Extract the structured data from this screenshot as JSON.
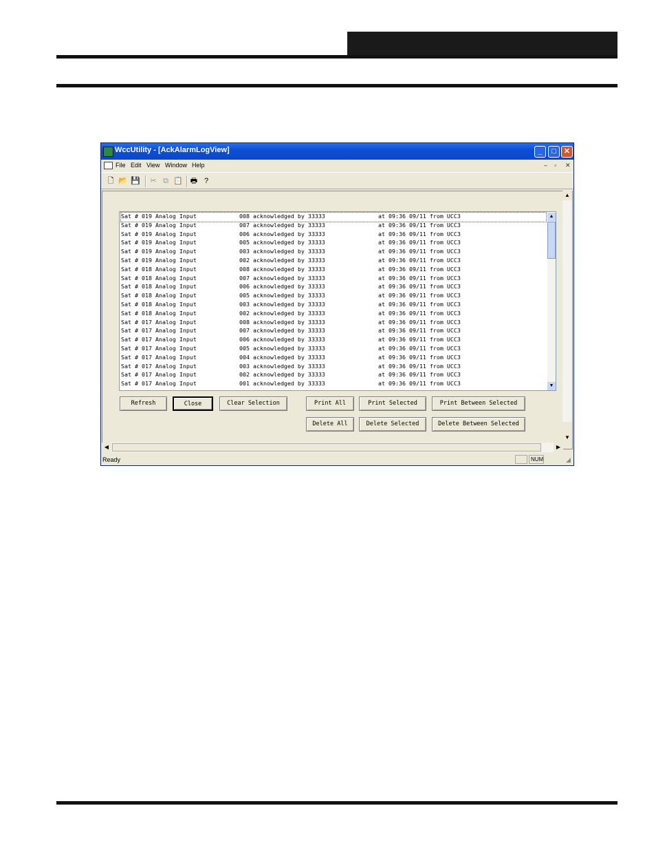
{
  "window": {
    "title": "WccUtility - [AckAlarmLogView]",
    "menu": [
      "File",
      "Edit",
      "View",
      "Window",
      "Help"
    ],
    "title_buttons": {
      "minimize": "_",
      "maximize": "□",
      "close": "✕"
    },
    "mdi_controls": {
      "minimize": "–",
      "restore": "▫",
      "close": "✕"
    }
  },
  "toolbar": {
    "icons": [
      "new-icon",
      "open-icon",
      "save-icon",
      "cut-icon",
      "copy-icon",
      "paste-icon",
      "print-icon",
      "help-icon"
    ]
  },
  "log": {
    "rows": [
      [
        "Sat # 019 Analog Input",
        "008 acknowledged by 33333",
        "at 09:36 09/11 from UCC3"
      ],
      [
        "Sat # 019 Analog Input",
        "007 acknowledged by 33333",
        "at 09:36 09/11 from UCC3"
      ],
      [
        "Sat # 019 Analog Input",
        "006 acknowledged by 33333",
        "at 09:36 09/11 from UCC3"
      ],
      [
        "Sat # 019 Analog Input",
        "005 acknowledged by 33333",
        "at 09:36 09/11 from UCC3"
      ],
      [
        "Sat # 019 Analog Input",
        "003 acknowledged by 33333",
        "at 09:36 09/11 from UCC3"
      ],
      [
        "Sat # 019 Analog Input",
        "002 acknowledged by 33333",
        "at 09:36 09/11 from UCC3"
      ],
      [
        "Sat # 018 Analog Input",
        "008 acknowledged by 33333",
        "at 09:36 09/11 from UCC3"
      ],
      [
        "Sat # 018 Analog Input",
        "007 acknowledged by 33333",
        "at 09:36 09/11 from UCC3"
      ],
      [
        "Sat # 018 Analog Input",
        "006 acknowledged by 33333",
        "at 09:36 09/11 from UCC3"
      ],
      [
        "Sat # 018 Analog Input",
        "005 acknowledged by 33333",
        "at 09:36 09/11 from UCC3"
      ],
      [
        "Sat # 018 Analog Input",
        "003 acknowledged by 33333",
        "at 09:36 09/11 from UCC3"
      ],
      [
        "Sat # 018 Analog Input",
        "002 acknowledged by 33333",
        "at 09:36 09/11 from UCC3"
      ],
      [
        "Sat # 017 Analog Input",
        "008 acknowledged by 33333",
        "at 09:36 09/11 from UCC3"
      ],
      [
        "Sat # 017 Analog Input",
        "007 acknowledged by 33333",
        "at 09:36 09/11 from UCC3"
      ],
      [
        "Sat # 017 Analog Input",
        "006 acknowledged by 33333",
        "at 09:36 09/11 from UCC3"
      ],
      [
        "Sat # 017 Analog Input",
        "005 acknowledged by 33333",
        "at 09:36 09/11 from UCC3"
      ],
      [
        "Sat # 017 Analog Input",
        "004 acknowledged by 33333",
        "at 09:36 09/11 from UCC3"
      ],
      [
        "Sat # 017 Analog Input",
        "003 acknowledged by 33333",
        "at 09:36 09/11 from UCC3"
      ],
      [
        "Sat # 017 Analog Input",
        "002 acknowledged by 33333",
        "at 09:36 09/11 from UCC3"
      ],
      [
        "Sat # 017 Analog Input",
        "001 acknowledged by 33333",
        "at 09:36 09/11 from UCC3"
      ]
    ]
  },
  "buttons": {
    "refresh": "Refresh",
    "close": "Close",
    "clear_selection": "Clear Selection",
    "print_all": "Print All",
    "print_selected": "Print Selected",
    "print_between_selected": "Print Between Selected",
    "delete_all": "Delete All",
    "delete_selected": "Delete Selected",
    "delete_between_selected": "Delete Between Selected"
  },
  "scroll_glyphs": {
    "up": "▲",
    "down": "▼",
    "left": "◀",
    "right": "▶"
  },
  "status": {
    "text": "Ready",
    "num": "NUM"
  }
}
